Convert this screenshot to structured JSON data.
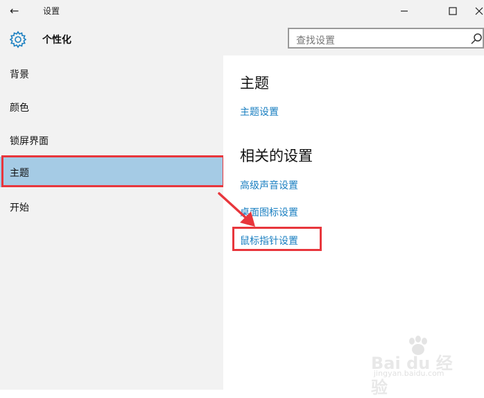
{
  "window": {
    "back": "←",
    "title": "设置",
    "minimize": "—",
    "maximize": "☐",
    "close": "✕"
  },
  "header": {
    "page_title": "个性化",
    "search_placeholder": "查找设置"
  },
  "sidebar": {
    "items": [
      {
        "label": "背景"
      },
      {
        "label": "颜色"
      },
      {
        "label": "锁屏界面"
      },
      {
        "label": "主题"
      },
      {
        "label": "开始"
      }
    ],
    "selected_index": 3,
    "selected_color": "#a5cbe5"
  },
  "main": {
    "theme_heading": "主题",
    "theme_settings_link": "主题设置",
    "related_heading": "相关的设置",
    "related_links": [
      {
        "label": "高级声音设置"
      },
      {
        "label": "桌面图标设置"
      },
      {
        "label": "鼠标指针设置"
      }
    ]
  },
  "annotation_color": "#e8363c",
  "link_color": "#1a7fc1",
  "watermark": {
    "brand": "Bai du 经验",
    "url": "jingyan.baidu.com"
  }
}
